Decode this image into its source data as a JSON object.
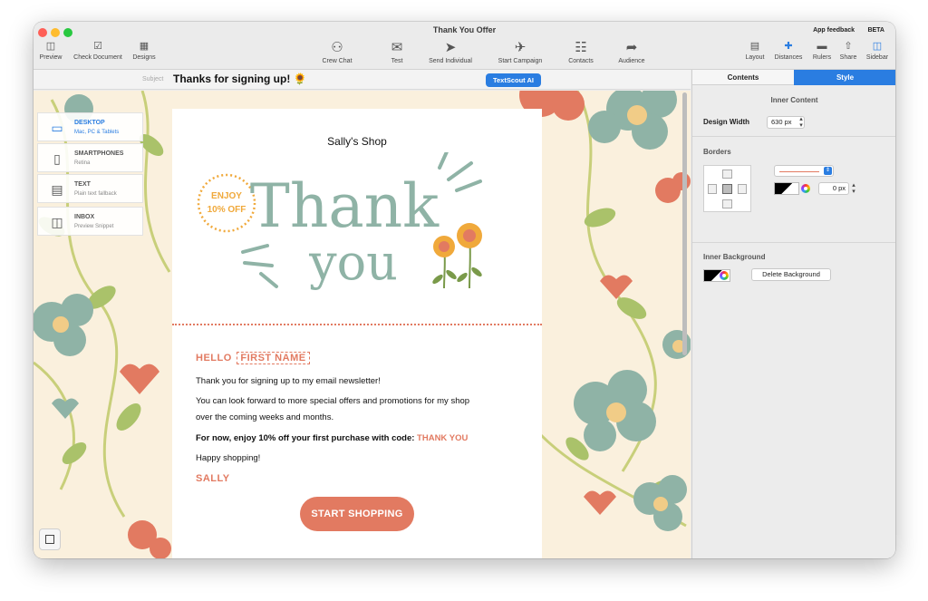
{
  "window": {
    "title": "Thank You Offer",
    "app_feedback": "App feedback",
    "beta": "BETA"
  },
  "toolbar": {
    "left": [
      {
        "label": "Preview",
        "icon": "preview-icon"
      },
      {
        "label": "Check Document",
        "icon": "check-icon"
      },
      {
        "label": "Designs",
        "icon": "designs-icon"
      }
    ],
    "center": [
      {
        "label": "Crew Chat",
        "icon": "people-icon"
      },
      {
        "label": "Test",
        "icon": "envelope-icon"
      },
      {
        "label": "Send Individual",
        "icon": "send-individual-icon"
      },
      {
        "label": "Start Campaign",
        "icon": "plane-icon"
      },
      {
        "label": "Contacts",
        "icon": "contacts-icon"
      },
      {
        "label": "Audience",
        "icon": "signpost-icon"
      }
    ],
    "right": [
      {
        "label": "Layout",
        "icon": "layout-icon"
      },
      {
        "label": "Distances",
        "icon": "distances-icon"
      },
      {
        "label": "Rulers",
        "icon": "ruler-icon"
      },
      {
        "label": "Share",
        "icon": "share-icon"
      },
      {
        "label": "Sidebar",
        "icon": "sidebar-icon"
      }
    ]
  },
  "subject": {
    "label": "Subject",
    "text": "Thanks for signing up! 🌻",
    "ai_button": "TextScout AI"
  },
  "devices": [
    {
      "title": "DESKTOP",
      "subtitle": "Mac, PC & Tablets",
      "icon": "laptop-icon"
    },
    {
      "title": "SMARTPHONES",
      "subtitle": "Retina",
      "icon": "phone-icon"
    },
    {
      "title": "TEXT",
      "subtitle": "Plain text fallback",
      "icon": "text-doc-icon"
    },
    {
      "title": "INBOX",
      "subtitle": "Preview Snippet",
      "icon": "inbox-icon"
    }
  ],
  "email": {
    "shop_name": "Sally's Shop",
    "badge_line1": "ENJOY",
    "badge_line2": "10% OFF",
    "hero_line1": "Thank",
    "hero_line2": "you",
    "hello": "HELLO",
    "first_name": "FIRST NAME",
    "thanks_line": "Thank you for signing up to my email newsletter!",
    "promo_line1": "You can look forward to more special offers and promotions for my shop",
    "promo_line2": "over the coming weeks and months.",
    "offer_prefix": "For now, enjoy 10% off your first purchase with code:",
    "offer_code": "THANK YOU",
    "happy": "Happy shopping!",
    "signature": "SALLY",
    "cta": "START SHOPPING"
  },
  "sidebar": {
    "tabs": [
      "Contents",
      "Style"
    ],
    "inner_content": {
      "title": "Inner Content",
      "design_width_label": "Design Width",
      "design_width_value": "630 px"
    },
    "borders": {
      "title": "Borders",
      "width_value": "0 px"
    },
    "inner_background": {
      "title": "Inner Background",
      "delete_button": "Delete Background"
    }
  },
  "colors": {
    "accent": "#2a7de1",
    "coral": "#e27a61",
    "sage": "#8fb3a6",
    "cream": "#faf0dd"
  }
}
